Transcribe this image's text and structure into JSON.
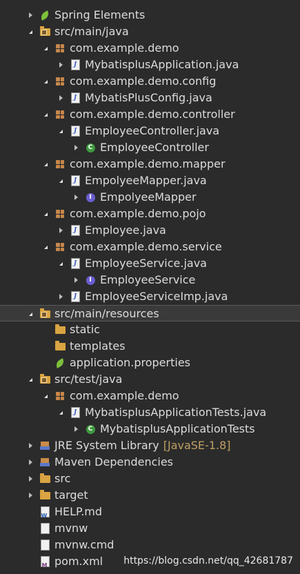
{
  "tree": [
    {
      "label": "Spring Elements",
      "icon": "spring-leaf-icon",
      "toggle": "collapsed"
    },
    {
      "label": "src/main/java",
      "icon": "source-folder-icon",
      "toggle": "expanded"
    },
    {
      "label": "com.example.demo",
      "icon": "package-icon",
      "toggle": "expanded"
    },
    {
      "label": "MybatisplusApplication.java",
      "icon": "java-file-icon",
      "toggle": "collapsed"
    },
    {
      "label": "com.example.demo.config",
      "icon": "package-icon",
      "toggle": "expanded"
    },
    {
      "label": "MybatisPlusConfig.java",
      "icon": "java-file-icon",
      "toggle": "collapsed"
    },
    {
      "label": "com.example.demo.controller",
      "icon": "package-icon",
      "toggle": "expanded"
    },
    {
      "label": "EmployeeController.java",
      "icon": "java-file-icon",
      "toggle": "expanded"
    },
    {
      "label": "EmployeeController",
      "icon": "class-icon",
      "toggle": "collapsed"
    },
    {
      "label": "com.example.demo.mapper",
      "icon": "package-icon",
      "toggle": "expanded"
    },
    {
      "label": "EmpolyeeMapper.java",
      "icon": "java-file-icon",
      "toggle": "expanded"
    },
    {
      "label": "EmpolyeeMapper",
      "icon": "interface-icon",
      "toggle": "collapsed"
    },
    {
      "label": "com.example.demo.pojo",
      "icon": "package-icon",
      "toggle": "expanded"
    },
    {
      "label": "Employee.java",
      "icon": "java-file-icon",
      "toggle": "collapsed"
    },
    {
      "label": "com.example.demo.service",
      "icon": "package-icon",
      "toggle": "expanded"
    },
    {
      "label": "EmployeeService.java",
      "icon": "java-file-icon",
      "toggle": "expanded"
    },
    {
      "label": "EmployeeService",
      "icon": "interface-icon",
      "toggle": "collapsed"
    },
    {
      "label": "EmployeeServiceImp.java",
      "icon": "java-file-icon",
      "toggle": "collapsed"
    },
    {
      "label": "src/main/resources",
      "icon": "source-folder-icon",
      "toggle": "expanded"
    },
    {
      "label": "static",
      "icon": "folder-icon",
      "toggle": "none"
    },
    {
      "label": "templates",
      "icon": "folder-icon",
      "toggle": "none"
    },
    {
      "label": "application.properties",
      "icon": "spring-leaf-icon",
      "toggle": "none"
    },
    {
      "label": "src/test/java",
      "icon": "source-folder-icon",
      "toggle": "expanded"
    },
    {
      "label": "com.example.demo",
      "icon": "package-icon",
      "toggle": "expanded"
    },
    {
      "label": "MybatisplusApplicationTests.java",
      "icon": "java-file-icon",
      "toggle": "expanded"
    },
    {
      "label": "MybatisplusApplicationTests",
      "icon": "class-icon",
      "toggle": "collapsed"
    },
    {
      "label": "JRE System Library",
      "decoration": "[JavaSE-1.8]",
      "icon": "library-icon",
      "toggle": "collapsed"
    },
    {
      "label": "Maven Dependencies",
      "icon": "library-icon",
      "toggle": "collapsed"
    },
    {
      "label": "src",
      "icon": "folder-icon",
      "toggle": "collapsed"
    },
    {
      "label": "target",
      "icon": "folder-icon",
      "toggle": "collapsed"
    },
    {
      "label": "HELP.md",
      "icon": "markdown-file-icon",
      "toggle": "none"
    },
    {
      "label": "mvnw",
      "icon": "file-icon",
      "toggle": "none"
    },
    {
      "label": "mvnw.cmd",
      "icon": "file-icon",
      "toggle": "none"
    },
    {
      "label": "pom.xml",
      "icon": "maven-pom-icon",
      "toggle": "none"
    }
  ],
  "selected_label": "src/main/resources",
  "watermark": "https://blog.csdn.net/qq_42681787",
  "colors": {
    "background": "#2b2b2b",
    "text": "#dcdcdc",
    "selection": "#3a3a3a",
    "decoration": "#c0a064"
  }
}
